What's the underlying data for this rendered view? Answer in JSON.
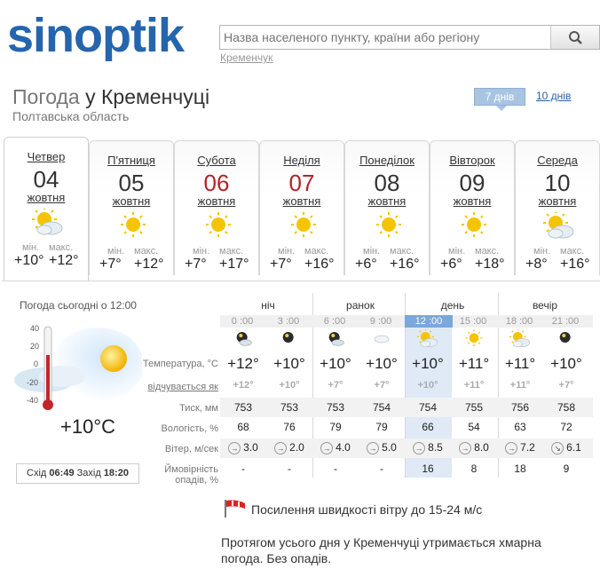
{
  "logo": {
    "text": "sinoptik"
  },
  "search": {
    "placeholder": "Назва населеного пункту, країни або регіону",
    "hint": "Кременчук"
  },
  "title": {
    "prefix": "Погода",
    "city": "у Кременчуці",
    "region": "Полтавська область"
  },
  "range_tabs": {
    "active": "7 днів",
    "other": "10 днів"
  },
  "days": [
    {
      "name": "Четвер",
      "date": "04",
      "month": "жовтня",
      "weekend": false,
      "icon": "cloudy-sun-icon",
      "min_label": "мін.",
      "max_label": "макс.",
      "min": "+10°",
      "max": "+12°"
    },
    {
      "name": "П'ятниця",
      "date": "05",
      "month": "жовтня",
      "weekend": false,
      "icon": "sun-icon",
      "min_label": "мін.",
      "max_label": "макс.",
      "min": "+7°",
      "max": "+12°"
    },
    {
      "name": "Субота",
      "date": "06",
      "month": "жовтня",
      "weekend": true,
      "icon": "sun-icon",
      "min_label": "мін.",
      "max_label": "макс.",
      "min": "+7°",
      "max": "+17°"
    },
    {
      "name": "Неділя",
      "date": "07",
      "month": "жовтня",
      "weekend": true,
      "icon": "sun-icon",
      "min_label": "мін.",
      "max_label": "макс.",
      "min": "+7°",
      "max": "+16°"
    },
    {
      "name": "Понеділок",
      "date": "08",
      "month": "жовтня",
      "weekend": false,
      "icon": "sun-icon",
      "min_label": "мін.",
      "max_label": "макс.",
      "min": "+6°",
      "max": "+16°"
    },
    {
      "name": "Вівторок",
      "date": "09",
      "month": "жовтня",
      "weekend": false,
      "icon": "sun-icon",
      "min_label": "мін.",
      "max_label": "макс.",
      "min": "+6°",
      "max": "+18°"
    },
    {
      "name": "Середа",
      "date": "10",
      "month": "жовтня",
      "weekend": false,
      "icon": "cloudy-sun-icon",
      "min_label": "мін.",
      "max_label": "макс.",
      "min": "+8°",
      "max": "+16°"
    }
  ],
  "today": {
    "title": "Погода сьогодні о 12:00",
    "scale": [
      "40",
      "20",
      "0",
      "-20",
      "-40"
    ],
    "temp": "+10°C",
    "sunrise_label": "Схід",
    "sunrise": "06:49",
    "sunset_label": "Захід",
    "sunset": "18:20"
  },
  "periods": [
    "ніч",
    "ранок",
    "день",
    "вечір"
  ],
  "hours": [
    "0 :00",
    "3 :00",
    "6 :00",
    "9 :00",
    "12 :00",
    "15 :00",
    "18 :00",
    "21 :00"
  ],
  "hour_icons": [
    "moon-cloud-icon",
    "moon-icon",
    "moon-cloud-icon",
    "cloud-icon",
    "cloudy-sun-icon",
    "sun-icon",
    "cloudy-sun-icon",
    "moon-icon"
  ],
  "labels": {
    "temp": "Температура, °C",
    "feels": "відчувається як",
    "pressure": "Тиск, мм",
    "humidity": "Вологість, %",
    "wind": "Вітер, м/сек",
    "precip1": "Ймовірність",
    "precip2": "опадів, %"
  },
  "temps": [
    "+12°",
    "+10°",
    "+10°",
    "+10°",
    "+10°",
    "+11°",
    "+11°",
    "+10°"
  ],
  "feels": [
    "+12°",
    "+10°",
    "+7°",
    "+7°",
    "+10°",
    "+11°",
    "+11°",
    "+7°"
  ],
  "pressure": [
    "753",
    "753",
    "753",
    "754",
    "754",
    "755",
    "756",
    "758"
  ],
  "humidity": [
    "68",
    "76",
    "79",
    "79",
    "66",
    "54",
    "63",
    "72"
  ],
  "wind": [
    "3.0",
    "2.0",
    "4.0",
    "5.0",
    "8.5",
    "8.0",
    "7.2",
    "6.1"
  ],
  "wind_dir": [
    "→",
    "→",
    "→",
    "→",
    "→",
    "→",
    "→",
    "↘"
  ],
  "precip": [
    "-",
    "-",
    "-",
    "-",
    "16",
    "8",
    "18",
    "9"
  ],
  "alert": "Посилення швидкості вітру до 15-24 м/с",
  "description": "Протягом усього дня у Кременчуці утримається хмарна погода. Без опадів.",
  "colors": {
    "brand": "#2565ae",
    "weekend": "#b3242a",
    "current_hour": "#7aa7dc",
    "day_band": "#dfeaf6"
  }
}
